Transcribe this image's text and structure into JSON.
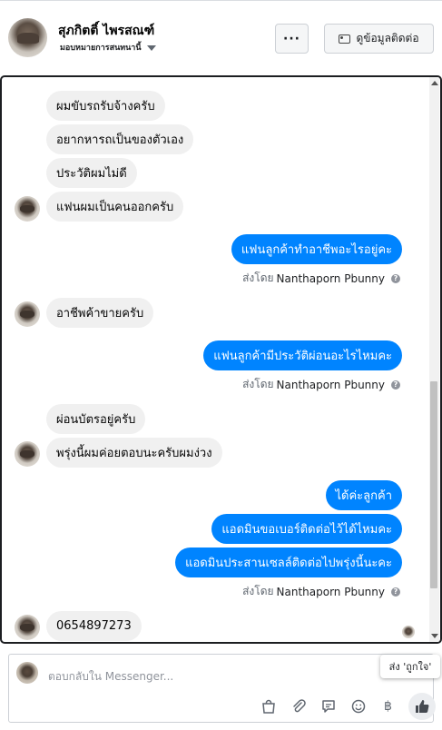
{
  "header": {
    "name": "สุภกิตติ์ ไพรสณฑ์",
    "subtitle": "มอบหมายการสนทนานี้",
    "more_label": "···",
    "contact_label": "ดูข้อมูลติดต่อ"
  },
  "messages": [
    {
      "dir": "in",
      "text": "ผมขับรถรับจ้างครับ"
    },
    {
      "dir": "in",
      "text": "อยากหารถเป็นของตัวเอง"
    },
    {
      "dir": "in",
      "text": "ประวัติผมไม่ดี"
    },
    {
      "dir": "in",
      "text": "แฟนผมเป็นคนออกครับ"
    },
    {
      "dir": "out",
      "text": "แฟนลูกค้าทำอาชีพอะไรอยู่คะ"
    },
    {
      "dir": "in",
      "text": "อาชีพค้าขายครับ"
    },
    {
      "dir": "out",
      "text": "แฟนลูกค้ามีประวัติผ่อนอะไรไหมคะ"
    },
    {
      "dir": "in",
      "text": "ผ่อนบัตรอยู่ครับ"
    },
    {
      "dir": "in",
      "text": "พรุ่งนี้ผมค่อยตอบนะครับผมง่วง"
    },
    {
      "dir": "out",
      "text": "ได้ค่ะลูกค้า"
    },
    {
      "dir": "out",
      "text": "แอดมินขอเบอร์ติดต่อไว้ได้ไหมคะ"
    },
    {
      "dir": "out",
      "text": "แอดมินประสานเซลล์ติดต่อไปพรุ่งนี้นะคะ"
    },
    {
      "dir": "in",
      "text": "0654897273"
    }
  ],
  "sent_by": {
    "prefix": "ส่งโดย",
    "sender": "Nanthaporn Pbunny"
  },
  "composer": {
    "placeholder": "ตอบกลับใน Messenger...",
    "like_tooltip": "ส่ง 'ถูกใจ'"
  },
  "colors": {
    "outgoing": "#0084ff",
    "incoming": "#f0f0f0"
  },
  "icons": {
    "more": "more-dots-icon",
    "contact": "contact-card-icon",
    "tools": [
      "shopping-bag-icon",
      "paperclip-icon",
      "chat-bubble-icon",
      "smiley-icon",
      "baht-icon",
      "thumbs-up-icon"
    ]
  }
}
